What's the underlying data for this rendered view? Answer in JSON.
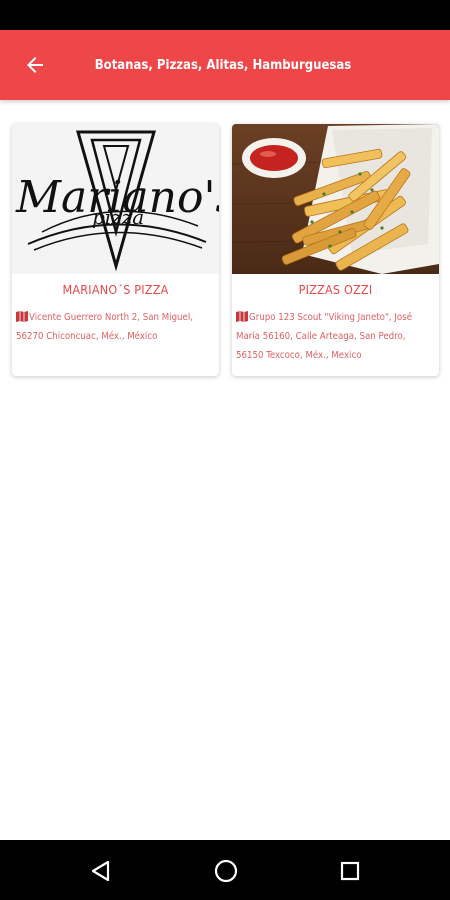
{
  "app_bar": {
    "title": "Botanas, Pizzas, Alitas, Hamburguesas",
    "back_icon": "arrow-left-icon",
    "color": "#ef4749"
  },
  "restaurants": [
    {
      "name": "MARIANO´S PIZZA",
      "address": "Vicente Guerrero North 2, San Miguel, 56270 Chiconcuac, Méx., México",
      "image": "marianos-pizza-logo",
      "logo_text": "Mariano's",
      "logo_subtext": "pizza"
    },
    {
      "name": "PIZZAS OZZI",
      "address": "Grupo 123 Scout \"Viking Janeto\", José María 56160, Calle Arteaga, San Pedro, 56150 Texcoco, Méx., Mexico",
      "image": "french-fries-photo"
    }
  ],
  "nav": {
    "back_icon": "triangle-back-icon",
    "home_icon": "circle-home-icon",
    "recent_icon": "square-recents-icon"
  },
  "colors": {
    "accent": "#ef4749",
    "card_title": "#e8484a",
    "card_text": "#e06063"
  }
}
